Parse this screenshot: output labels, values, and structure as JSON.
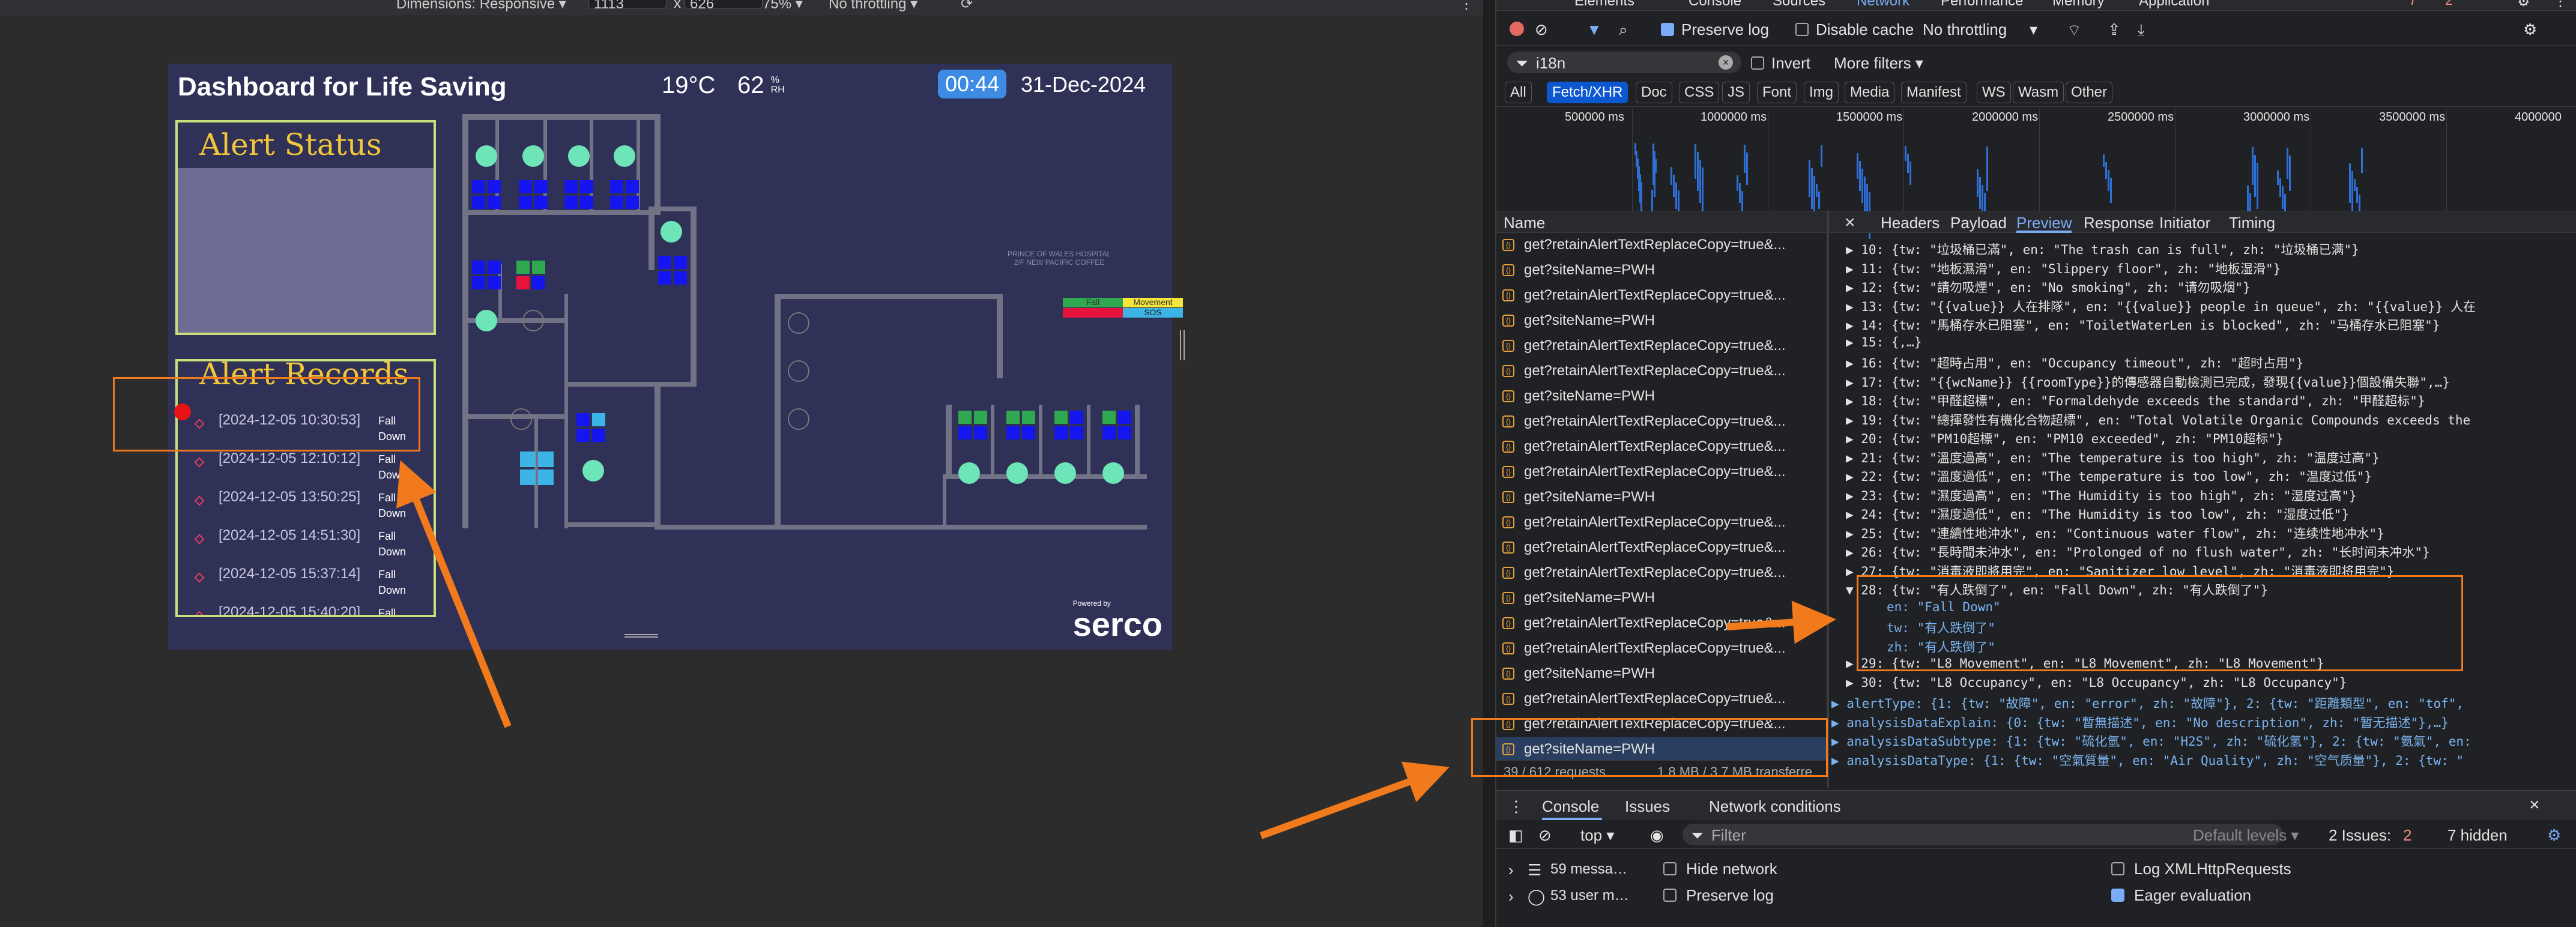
{
  "device_toolbar": {
    "dimensions_label": "Dimensions: Responsive ▾",
    "width_value": "1113",
    "height_value": "626",
    "zoom": "75% ▾",
    "throttling": "No throttling ▾"
  },
  "dashboard": {
    "title": "Dashboard for Life Saving",
    "temperature": "19°C",
    "humidity_value": "62",
    "humidity_unit_top": "%",
    "humidity_unit_bottom": "RH",
    "time": "00:44",
    "date": "31-Dec-2024",
    "alert_status_title": "Alert Status",
    "alert_records_title": "Alert Records",
    "records": [
      {
        "ts": "[2024-12-05 10:30:53]",
        "type_line1": "Fall",
        "type_line2": "Down"
      },
      {
        "ts": "[2024-12-05 12:10:12]",
        "type_line1": "Fall",
        "type_line2": "Down"
      },
      {
        "ts": "[2024-12-05 13:50:25]",
        "type_line1": "Fall",
        "type_line2": "Down"
      },
      {
        "ts": "[2024-12-05 14:51:30]",
        "type_line1": "Fall",
        "type_line2": "Down"
      },
      {
        "ts": "[2024-12-05 15:37:14]",
        "type_line1": "Fall",
        "type_line2": "Down"
      },
      {
        "ts": "[2024-12-05 15:40:20]",
        "type_line1": "Fall",
        "type_line2": ""
      }
    ],
    "floor_label_line1": "PRINCE OF WALES HOSPITAL",
    "floor_label_line2": "2/F NEW PACIFIC COFFEE",
    "legend": [
      {
        "label": "Fall",
        "color": "#2fa84f"
      },
      {
        "label": "Movement",
        "color": "#f5e63a"
      },
      {
        "label": "Occupancy",
        "color": "#e6143c"
      },
      {
        "label": "SOS",
        "color": "#3cb4e6"
      }
    ],
    "powered_by": "Powered by",
    "brand": "serco"
  },
  "devtools": {
    "top_tabs": [
      "Elements",
      "Console",
      "Sources",
      "Network",
      "Performance",
      "Memory",
      "Application"
    ],
    "active_tab": "Network",
    "error_count": "7",
    "warn_count": "2",
    "preserve_log": "Preserve log",
    "disable_cache": "Disable cache",
    "throttling": "No throttling",
    "filter_value": "i18n",
    "invert": "Invert",
    "more_filters": "More filters ▾",
    "type_filters": [
      "All",
      "Fetch/XHR",
      "Doc",
      "CSS",
      "JS",
      "Font",
      "Img",
      "Media",
      "Manifest",
      "WS",
      "Wasm",
      "Other"
    ],
    "active_type": "Fetch/XHR",
    "timeline_ticks": [
      "500000 ms",
      "1000000 ms",
      "1500000 ms",
      "2000000 ms",
      "2500000 ms",
      "3000000 ms",
      "3500000 ms",
      "4000000"
    ],
    "name_header": "Name",
    "detail_tabs": [
      "Headers",
      "Payload",
      "Preview",
      "Response",
      "Initiator",
      "Timing"
    ],
    "active_detail_tab": "Preview",
    "requests": [
      "get?retainAlertTextReplaceCopy=true&...",
      "get?siteName=PWH",
      "get?retainAlertTextReplaceCopy=true&...",
      "get?siteName=PWH",
      "get?retainAlertTextReplaceCopy=true&...",
      "get?retainAlertTextReplaceCopy=true&...",
      "get?siteName=PWH",
      "get?retainAlertTextReplaceCopy=true&...",
      "get?retainAlertTextReplaceCopy=true&...",
      "get?retainAlertTextReplaceCopy=true&...",
      "get?siteName=PWH",
      "get?retainAlertTextReplaceCopy=true&...",
      "get?retainAlertTextReplaceCopy=true&...",
      "get?retainAlertTextReplaceCopy=true&...",
      "get?siteName=PWH",
      "get?retainAlertTextReplaceCopy=true&...",
      "get?retainAlertTextReplaceCopy=true&...",
      "get?siteName=PWH",
      "get?retainAlertTextReplaceCopy=true&...",
      "get?retainAlertTextReplaceCopy=true&...",
      "get?siteName=PWH"
    ],
    "status_bar": "39 / 612 requests",
    "status_bar_size": "1.8 MB / 3.7 MB transferre",
    "preview_lines": [
      {
        "t": "▶ 10: {tw: \"垃圾桶已滿\", en: \"The trash can is full\", zh: \"垃圾桶已满\"}"
      },
      {
        "t": "▶ 11: {tw: \"地板濕滑\", en: \"Slippery floor\", zh: \"地板湿滑\"}"
      },
      {
        "t": "▶ 12: {tw: \"請勿吸煙\", en: \"No smoking\", zh: \"请勿吸烟\"}"
      },
      {
        "t": "▶ 13: {tw: \"{{value}} 人在排隊\", en: \"{{value}} people in queue\", zh: \"{{value}} 人在"
      },
      {
        "t": "▶ 14: {tw: \"馬桶存水已阻塞\", en: \"ToiletWaterLen is blocked\", zh: \"马桶存水已阻塞\"}"
      },
      {
        "t": "▶ 15: {,…}"
      },
      {
        "t": "▶ 16: {tw: \"超時占用\", en: \"Occupancy timeout\", zh: \"超时占用\"}"
      },
      {
        "t": "▶ 17: {tw: \"{{wcName}} {{roomType}}的傳感器自動檢測已完成，發現{{value}}個設備失聯\",…}"
      },
      {
        "t": "▶ 18: {tw: \"甲醛超標\", en: \"Formaldehyde exceeds the standard\", zh: \"甲醛超标\"}"
      },
      {
        "t": "▶ 19: {tw: \"總揮發性有機化合物超標\", en: \"Total Volatile Organic Compounds exceeds the"
      },
      {
        "t": "▶ 20: {tw: \"PM10超標\", en: \"PM10 exceeded\", zh: \"PM10超标\"}"
      },
      {
        "t": "▶ 21: {tw: \"溫度過高\", en: \"The temperature is too high\", zh: \"温度过高\"}"
      },
      {
        "t": "▶ 22: {tw: \"溫度過低\", en: \"The temperature is too low\", zh: \"温度过低\"}"
      },
      {
        "t": "▶ 23: {tw: \"濕度過高\", en: \"The Humidity is too high\", zh: \"湿度过高\"}"
      },
      {
        "t": "▶ 24: {tw: \"濕度過低\", en: \"The Humidity is too low\", zh: \"湿度过低\"}"
      },
      {
        "t": "▶ 25: {tw: \"連續性地沖水\", en: \"Continuous water flow\", zh: \"连续性地冲水\"}"
      },
      {
        "t": "▶ 26: {tw: \"長時間未沖水\", en: \"Prolonged of no flush water\", zh: \"长时间未冲水\"}"
      },
      {
        "t": "▶ 27: {tw: \"消毒液即將用完\", en: \"Sanitizer low level\", zh: \"消毒液即将用完\"}"
      },
      {
        "t": "▼ 28: {tw: \"有人跌倒了\", en: \"Fall Down\", zh: \"有人跌倒了\"}"
      },
      {
        "t": "    en: \"Fall Down\""
      },
      {
        "t": "    tw: \"有人跌倒了\""
      },
      {
        "t": "    zh: \"有人跌倒了\""
      },
      {
        "t": "▶ 29: {tw: \"L8 Movement\", en: \"L8 Movement\", zh: \"L8 Movement\"}"
      },
      {
        "t": "▶ 30: {tw: \"L8 Occupancy\", en: \"L8 Occupancy\", zh: \"L8 Occupancy\"}"
      },
      {
        "t": "▶ alertType: {1: {tw: \"故障\", en: \"error\", zh: \"故障\"}, 2: {tw: \"距離類型\", en: \"tof\","
      },
      {
        "t": "▶ analysisDataExplain: {0: {tw: \"暫無描述\", en: \"No description\", zh: \"暂无描述\"},…}"
      },
      {
        "t": "▶ analysisDataSubtype: {1: {tw: \"硫化氫\", en: \"H2S\", zh: \"硫化氢\"}, 2: {tw: \"氨氣\", en:"
      },
      {
        "t": "▶ analysisDataType: {1: {tw: \"空氣質量\", en: \"Air Quality\", zh: \"空气质量\"}, 2: {tw: \""
      }
    ],
    "drawer_tabs": [
      "Console",
      "Issues",
      "Network conditions"
    ],
    "console_context": "top ▾",
    "console_filter_placeholder": "Filter",
    "default_levels": "Default levels ▾",
    "issues_label": "2 Issues:",
    "issues_count": "2",
    "hidden_count": "7 hidden",
    "sidebar_items": [
      "59 messa…",
      "53 user m…"
    ],
    "console_options": [
      {
        "label": "Hide network",
        "checked": false
      },
      {
        "label": "Preserve log",
        "checked": false
      },
      {
        "label": "Log XMLHttpRequests",
        "checked": false
      },
      {
        "label": "Eager evaluation",
        "checked": true
      }
    ]
  }
}
